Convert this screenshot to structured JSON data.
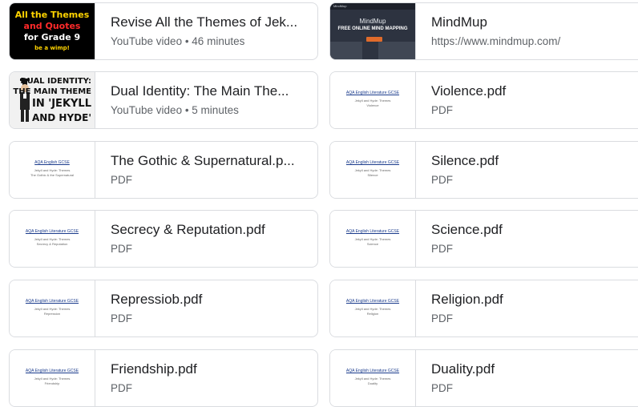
{
  "items": [
    {
      "title": "Revise All the Themes of Jek...",
      "subtitle": "YouTube video • 46 minutes",
      "thumb": {
        "kind": "yt1",
        "lines": [
          "All the Themes",
          "and Quotes",
          "for Grade 9",
          "be a wimp!"
        ]
      }
    },
    {
      "title": "MindMup",
      "subtitle": "https://www.mindmup.com/",
      "thumb": {
        "kind": "mindmup",
        "logo": "MindMup",
        "tagline": "FREE ONLINE MIND MAPPING"
      }
    },
    {
      "title": "Dual Identity: The Main The...",
      "subtitle": "YouTube video • 5 minutes",
      "thumb": {
        "kind": "yt2",
        "lines": [
          "DUAL IDENTITY:",
          "THE MAIN THEME",
          "IN 'JEKYLL",
          "AND HYDE'"
        ]
      }
    },
    {
      "title": "Violence.pdf",
      "subtitle": "PDF",
      "thumb": {
        "kind": "pdf",
        "heading": "AQA English Literature GCSE",
        "line1": "Jekyll and Hyde: Themes",
        "line2": "Violence"
      }
    },
    {
      "title": "The Gothic & Supernatural.p...",
      "subtitle": "PDF",
      "thumb": {
        "kind": "pdf",
        "heading": "AQA English GCSE",
        "line1": "Jekyll and Hyde: Themes",
        "line2": "The Gothic & the Supernatural"
      }
    },
    {
      "title": "Silence.pdf",
      "subtitle": "PDF",
      "thumb": {
        "kind": "pdf",
        "heading": "AQA English Literature GCSE",
        "line1": "Jekyll and Hyde: Themes",
        "line2": "Silence"
      }
    },
    {
      "title": "Secrecy & Reputation.pdf",
      "subtitle": "PDF",
      "thumb": {
        "kind": "pdf",
        "heading": "AQA English Literature GCSE",
        "line1": "Jekyll and Hyde: Themes",
        "line2": "Secrecy & Reputation"
      }
    },
    {
      "title": "Science.pdf",
      "subtitle": "PDF",
      "thumb": {
        "kind": "pdf",
        "heading": "AQA English Literature GCSE",
        "line1": "Jekyll and Hyde: Themes",
        "line2": "Science"
      }
    },
    {
      "title": "Repressiob.pdf",
      "subtitle": "PDF",
      "thumb": {
        "kind": "pdf",
        "heading": "AQA English Literature GCSE",
        "line1": "Jekyll and Hyde: Themes",
        "line2": "Repression"
      }
    },
    {
      "title": "Religion.pdf",
      "subtitle": "PDF",
      "thumb": {
        "kind": "pdf",
        "heading": "AQA English Literature GCSE",
        "line1": "Jekyll and Hyde: Themes",
        "line2": "Religion"
      }
    },
    {
      "title": "Friendship.pdf",
      "subtitle": "PDF",
      "thumb": {
        "kind": "pdf",
        "heading": "AQA English Literature GCSE",
        "line1": "Jekyll and Hyde: Themes",
        "line2": "Friendship"
      }
    },
    {
      "title": "Duality.pdf",
      "subtitle": "PDF",
      "thumb": {
        "kind": "pdf",
        "heading": "AQA English Literature GCSE",
        "line1": "Jekyll and Hyde: Themes",
        "line2": "Duality"
      }
    }
  ]
}
